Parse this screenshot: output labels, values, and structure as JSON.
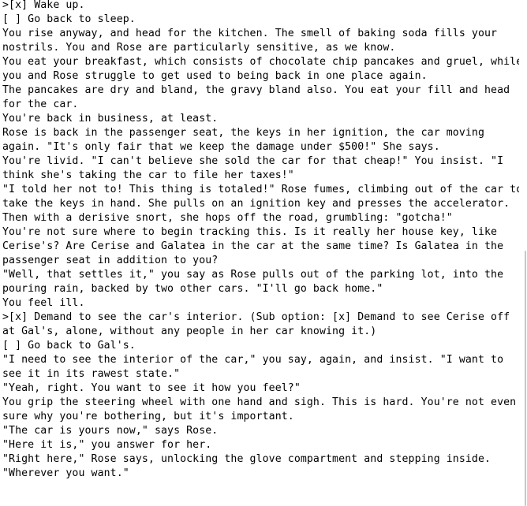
{
  "transcript": {
    "lines": [
      ">[x] Wake up.",
      "[ ] Go back to sleep.",
      "You rise anyway, and head for the kitchen. The smell of baking soda fills your",
      "nostrils. You and Rose are particularly sensitive, as we know.",
      "You eat your breakfast, which consists of chocolate chip pancakes and gruel, while",
      "you and Rose struggle to get used to being back in one place again.",
      "The pancakes are dry and bland, the gravy bland also. You eat your fill and head",
      "for the car.",
      "You're back in business, at least.",
      "Rose is back in the passenger seat, the keys in her ignition, the car moving",
      "again. \"It's only fair that we keep the damage under $500!\" She says.",
      "You're livid. \"I can't believe she sold the car for that cheap!\" You insist. \"I",
      "think she's taking the car to file her taxes!\"",
      "\"I told her not to! This thing is totaled!\" Rose fumes, climbing out of the car to",
      "take the keys in hand. She pulls on an ignition key and presses the accelerator.",
      "Then with a derisive snort, she hops off the road, grumbling: \"gotcha!\"",
      "You're not sure where to begin tracking this. Is it really her house key, like",
      "Cerise's? Are Cerise and Galatea in the car at the same time? Is Galatea in the",
      "passenger seat in addition to you?",
      "\"Well, that settles it,\" you say as Rose pulls out of the parking lot, into the",
      "pouring rain, backed by two other cars. \"I'll go back home.\"",
      "You feel ill.",
      ">[x] Demand to see the car's interior. (Sub option: [x] Demand to see Cerise off",
      "at Gal's, alone, without any people in her car knowing it.)",
      "[ ] Go back to Gal's.",
      "\"I need to see the interior of the car,\" you say, again, and insist. \"I want to",
      "see it in its rawest state.\"",
      "\"Yeah, right. You want to see it how you feel?\"",
      "You grip the steering wheel with one hand and sigh. This is hard. You're not even",
      "sure why you're bothering, but it's important.",
      "\"The car is yours now,\" says Rose.",
      "\"Here it is,\" you answer for her.",
      "\"Right here,\" Rose says, unlocking the glove compartment and stepping inside.",
      "\"Wherever you want.\""
    ]
  }
}
